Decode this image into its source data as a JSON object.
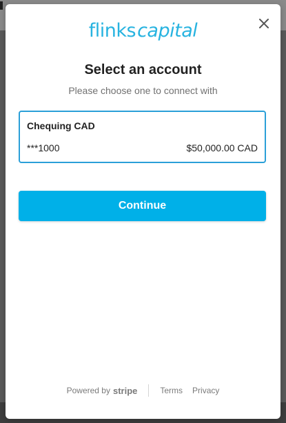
{
  "brand": {
    "logo_part1": "flinks",
    "logo_part2": "capital",
    "logo_color": "#27b3e0"
  },
  "modal": {
    "title": "Select an account",
    "subtitle": "Please choose one to connect with",
    "close_icon": "close-icon"
  },
  "accounts": [
    {
      "name": "Chequing CAD",
      "number": "***1000",
      "balance": "$50,000.00 CAD",
      "selected": true
    }
  ],
  "actions": {
    "continue_label": "Continue",
    "button_color": "#00b0e8"
  },
  "footer": {
    "powered_by": "Powered by",
    "stripe": "stripe",
    "terms": "Terms",
    "privacy": "Privacy"
  },
  "colors": {
    "selected_border": "#2a9fd8",
    "overlay": "#5a5a5a"
  }
}
